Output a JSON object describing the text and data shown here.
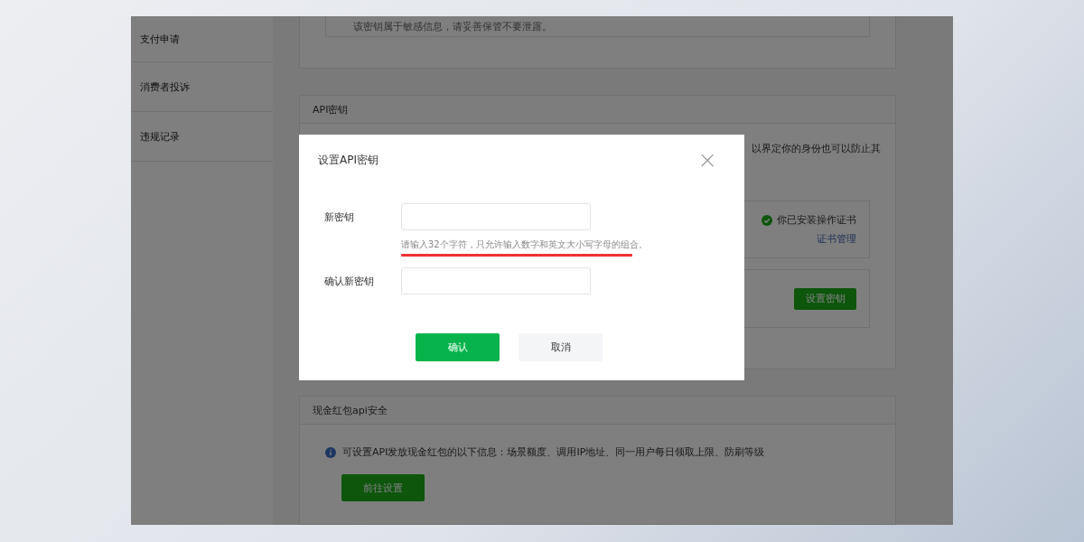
{
  "sidebar": {
    "items": [
      {
        "label": "支付申请"
      },
      {
        "label": "消费者投诉"
      },
      {
        "label": "违规记录"
      }
    ]
  },
  "notice_panel": {
    "text": "该密钥属于敏感信息，请妥善保管不要泄露。"
  },
  "api_key_panel": {
    "title": "API密钥",
    "description": "以界定你的身份也可以防止其",
    "certificate_status": "你已安装操作证书",
    "certificate_link": "证书管理",
    "set_key_button": "设置密钥"
  },
  "red_packet_panel": {
    "title": "现金红包api安全",
    "info": "可设置API发放现金红包的以下信息：场景额度、调用IP地址、同一用户每日领取上限、防刷等级",
    "button": "前往设置"
  },
  "dialog": {
    "title": "设置API密钥",
    "close": "×",
    "fields": [
      {
        "label": "新密钥",
        "hint": "请输入32个字符，只允许输入数字和英文大小写字母的组合。"
      },
      {
        "label": "确认新密钥"
      }
    ],
    "buttons": [
      {
        "label": "确认",
        "kind": "primary"
      },
      {
        "label": "取消",
        "kind": "secondary"
      }
    ]
  }
}
